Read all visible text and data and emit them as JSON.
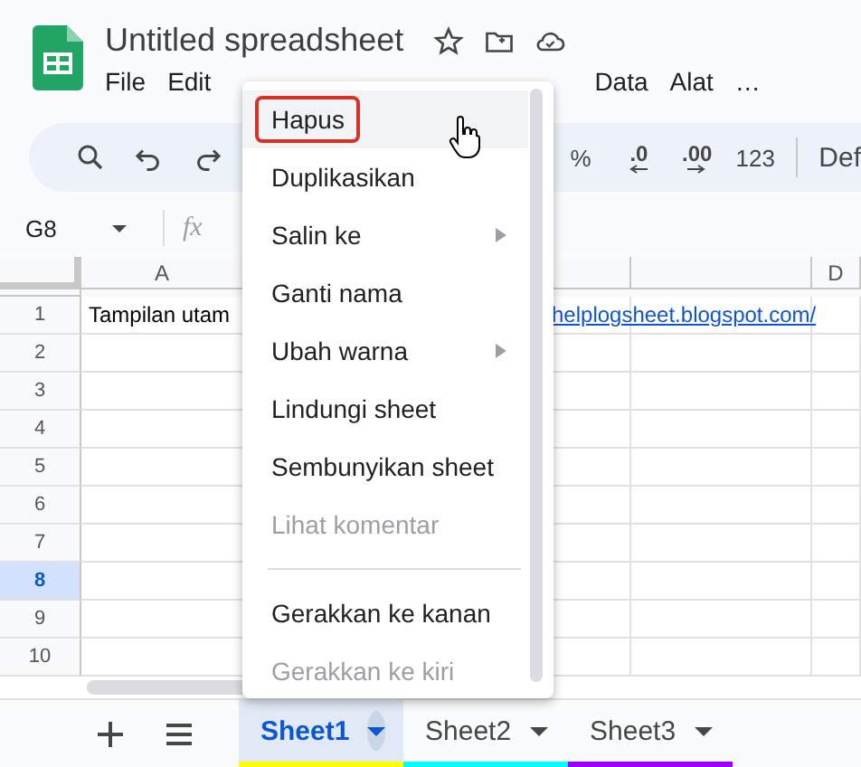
{
  "document": {
    "title": "Untitled spreadsheet"
  },
  "menu_bar": [
    "File",
    "Edit",
    "Data",
    "Alat"
  ],
  "more_menu": "…",
  "toolbar": {
    "percent": "%",
    "decrease_decimal": ".0",
    "increase_decimal": ".00",
    "number_format": "123",
    "font": "Def"
  },
  "name_box": "G8",
  "formula_label": "fx",
  "columns": [
    {
      "label": "A"
    },
    {},
    {},
    {
      "label": "D"
    }
  ],
  "rows": [
    {
      "number": "1",
      "selected": false,
      "cell_a": "Tampilan utam",
      "link": "helplogsheet.blogspot.com/"
    },
    {
      "number": "2",
      "selected": false
    },
    {
      "number": "3",
      "selected": false
    },
    {
      "number": "4",
      "selected": false
    },
    {
      "number": "5",
      "selected": false
    },
    {
      "number": "6",
      "selected": false
    },
    {
      "number": "7",
      "selected": false
    },
    {
      "number": "8",
      "selected": true
    },
    {
      "number": "9",
      "selected": false
    },
    {
      "number": "10",
      "selected": false
    }
  ],
  "context_menu": [
    {
      "kind": "item",
      "label": "Hapus",
      "disabled": false,
      "submenu": false,
      "highlighted": true
    },
    {
      "kind": "item",
      "label": "Duplikasikan",
      "disabled": false,
      "submenu": false,
      "highlighted": false
    },
    {
      "kind": "item",
      "label": "Salin ke",
      "disabled": false,
      "submenu": true,
      "highlighted": false
    },
    {
      "kind": "item",
      "label": "Ganti nama",
      "disabled": false,
      "submenu": false,
      "highlighted": false
    },
    {
      "kind": "item",
      "label": "Ubah warna",
      "disabled": false,
      "submenu": true,
      "highlighted": false
    },
    {
      "kind": "item",
      "label": "Lindungi sheet",
      "disabled": false,
      "submenu": false,
      "highlighted": false
    },
    {
      "kind": "item",
      "label": "Sembunyikan sheet",
      "disabled": false,
      "submenu": false,
      "highlighted": false
    },
    {
      "kind": "item",
      "label": "Lihat komentar",
      "disabled": true,
      "submenu": false,
      "highlighted": false
    },
    {
      "kind": "separator"
    },
    {
      "kind": "item",
      "label": "Gerakkan ke kanan",
      "disabled": false,
      "submenu": false,
      "highlighted": false
    },
    {
      "kind": "item",
      "label": "Gerakkan ke kiri",
      "disabled": true,
      "submenu": false,
      "highlighted": false
    }
  ],
  "sheet_tabs": [
    {
      "label": "Sheet1",
      "selected": true,
      "color": "#ffff00"
    },
    {
      "label": "Sheet2",
      "selected": false,
      "color": "#00ffff"
    },
    {
      "label": "Sheet3",
      "selected": false,
      "color": "#9900ff"
    }
  ]
}
